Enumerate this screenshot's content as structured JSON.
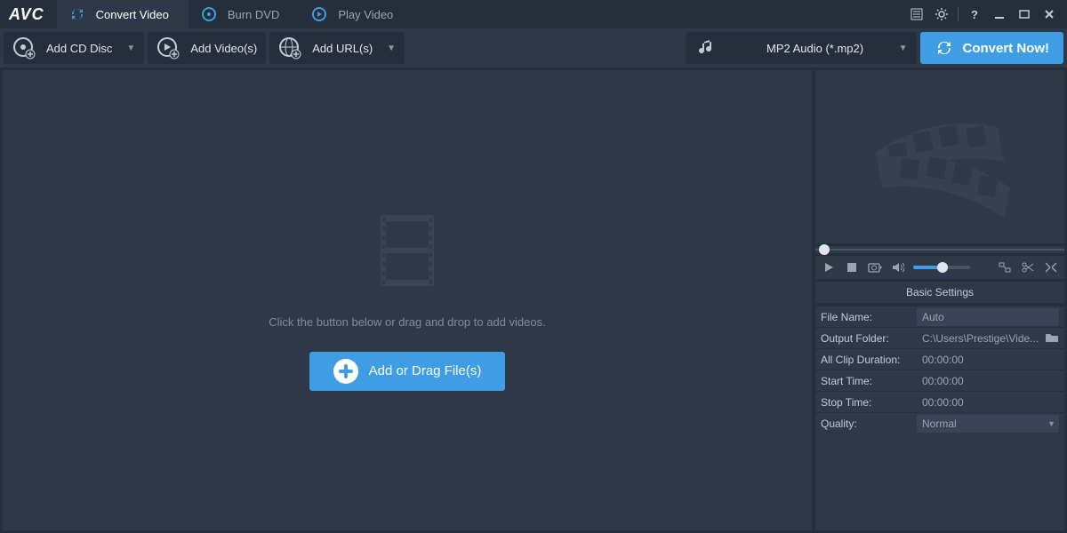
{
  "logo": "AVC",
  "tabs": [
    {
      "label": "Convert Video",
      "active": true
    },
    {
      "label": "Burn DVD",
      "active": false
    },
    {
      "label": "Play Video",
      "active": false
    }
  ],
  "toolbar": {
    "add_cd": "Add CD Disc",
    "add_videos": "Add Video(s)",
    "add_urls": "Add URL(s)"
  },
  "format": {
    "selected": "MP2 Audio (*.mp2)"
  },
  "convert_label": "Convert Now!",
  "dropzone": {
    "hint": "Click the button below or drag and drop to add videos.",
    "button": "Add or Drag File(s)"
  },
  "settings": {
    "header": "Basic Settings",
    "rows": {
      "file_name": {
        "label": "File Name:",
        "value": "Auto"
      },
      "output_folder": {
        "label": "Output Folder:",
        "value": "C:\\Users\\Prestige\\Vide..."
      },
      "all_clip_duration": {
        "label": "All Clip Duration:",
        "value": "00:00:00"
      },
      "start_time": {
        "label": "Start Time:",
        "value": "00:00:00"
      },
      "stop_time": {
        "label": "Stop Time:",
        "value": "00:00:00"
      },
      "quality": {
        "label": "Quality:",
        "value": "Normal"
      }
    }
  },
  "colors": {
    "accent": "#3f9de3",
    "panel": "#2e3848",
    "bg": "#262e3c"
  }
}
